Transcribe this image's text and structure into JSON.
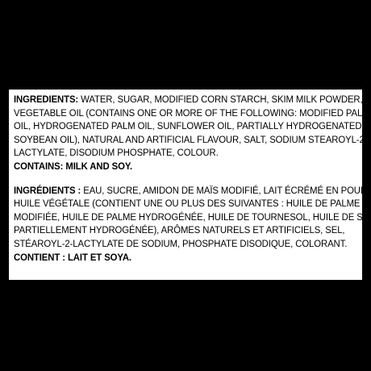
{
  "label": {
    "english": {
      "ingredients_heading": "INGREDIENTS:",
      "line1": " WATER, SUGAR, MODIFIED CORN STARCH, SKIM MILK POWDER,",
      "line2": "VEGETABLE OIL (CONTAINS ONE OR MORE OF THE FOLLOWING: MODIFIED PALM",
      "line3": "OIL, HYDROGENATED PALM OIL, SUNFLOWER OIL, PARTIALLY HYDROGENATED",
      "line4": "SOYBEAN OIL), NATURAL AND ARTIFICIAL FLAVOUR, SALT, SODIUM STEAROYL-2-",
      "line5": "LACTYLATE, DISODIUM PHOSPHATE, COLOUR.",
      "contains_heading": "CONTAINS:",
      "contains_text": " MILK AND SOY."
    },
    "french": {
      "ingredients_heading": "INGRÉDIENTS :",
      "line1": " EAU, SUCRE, AMIDON DE MAÏS MODIFIÉ, LAIT ÉCRÉMÉ EN POUDRE,",
      "line2": "HUILE VÉGÉTALE (CONTIENT UNE OU PLUS DES SUIVANTES : HUILE DE PALME",
      "line3": "MODIFIÉE, HUILE DE PALME HYDROGÉNÉE, HUILE DE TOURNESOL, HUILE DE SOYA",
      "line4": "PARTIELLEMENT HYDROGÉNÉE), ARÔMES NATURELS ET ARTIFICIELS, SEL,",
      "line5": "STÉAROYL-2-LACTYLATE DE SODIUM, PHOSPHATE DISODIQUE, COLORANT.",
      "contains_heading": "CONTIENT :",
      "contains_text": " LAIT ET SOYA."
    }
  }
}
